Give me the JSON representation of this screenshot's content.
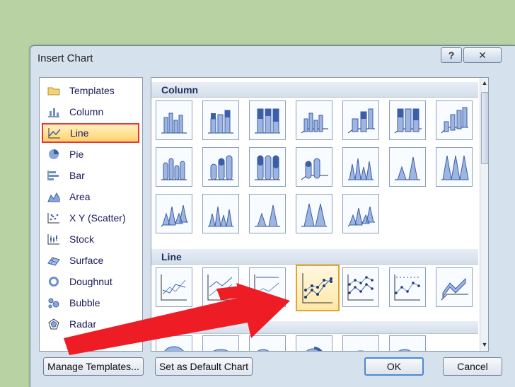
{
  "dialog": {
    "title": "Insert Chart",
    "help_label": "?",
    "close_label": "✕"
  },
  "categories": [
    {
      "label": "Templates",
      "icon": "folder-icon"
    },
    {
      "label": "Column",
      "icon": "column-chart-icon"
    },
    {
      "label": "Line",
      "icon": "line-chart-icon",
      "selected": true
    },
    {
      "label": "Pie",
      "icon": "pie-chart-icon"
    },
    {
      "label": "Bar",
      "icon": "bar-chart-icon"
    },
    {
      "label": "Area",
      "icon": "area-chart-icon"
    },
    {
      "label": "X Y (Scatter)",
      "icon": "scatter-chart-icon"
    },
    {
      "label": "Stock",
      "icon": "stock-chart-icon"
    },
    {
      "label": "Surface",
      "icon": "surface-chart-icon"
    },
    {
      "label": "Doughnut",
      "icon": "doughnut-chart-icon"
    },
    {
      "label": "Bubble",
      "icon": "bubble-chart-icon"
    },
    {
      "label": "Radar",
      "icon": "radar-chart-icon"
    }
  ],
  "sections": [
    {
      "label": "Column"
    },
    {
      "label": "Line"
    }
  ],
  "buttons": {
    "manage_templates": "Manage Templates...",
    "set_default": "Set as Default Chart",
    "ok": "OK",
    "cancel": "Cancel"
  },
  "colors": {
    "highlight": "#e33030",
    "selection": "#ffd36d",
    "accent": "#4b6fb0"
  }
}
